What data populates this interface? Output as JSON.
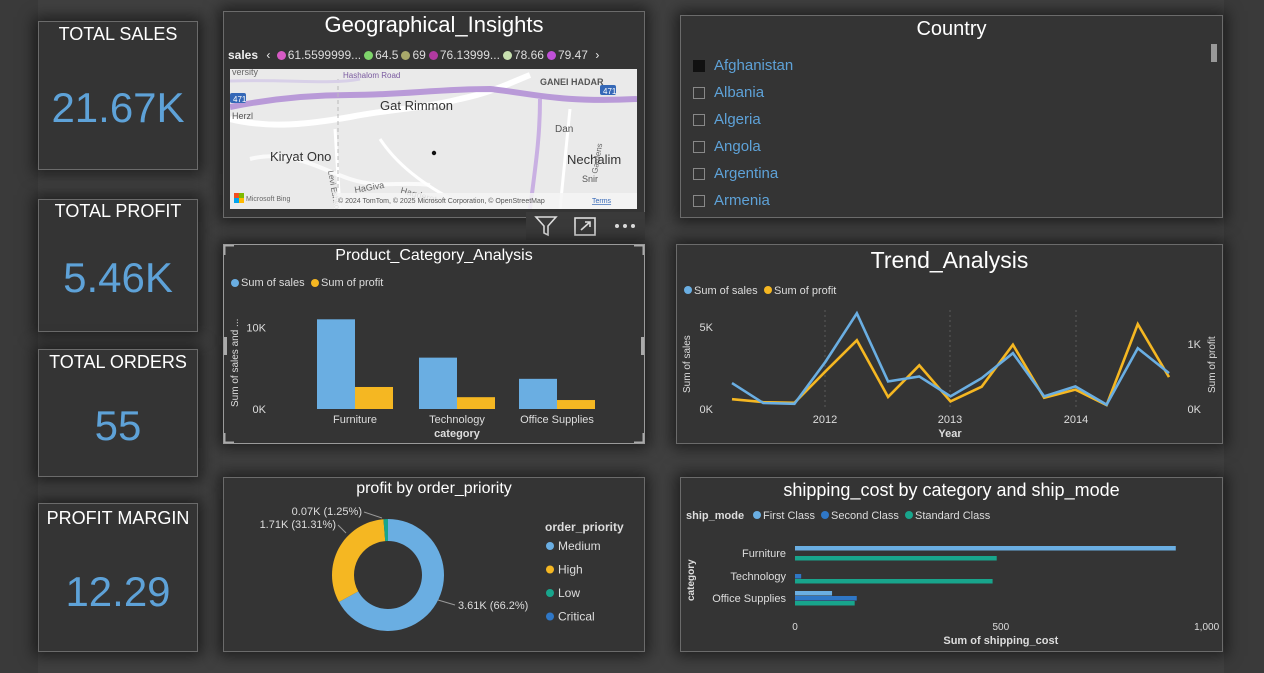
{
  "kpis": [
    {
      "label": "TOTAL SALES",
      "value": "21.67K"
    },
    {
      "label": "TOTAL PROFIT",
      "value": "5.46K"
    },
    {
      "label": "TOTAL ORDERS",
      "value": "55"
    },
    {
      "label": "PROFIT MARGIN",
      "value": "12.29"
    }
  ],
  "geo": {
    "title": "Geographical_Insights",
    "legend_title": "sales",
    "legend_items": [
      {
        "label": "61.5599999...",
        "color": "#d65ac4"
      },
      {
        "label": "64.5",
        "color": "#7ed46b"
      },
      {
        "label": "69",
        "color": "#a8a86a"
      },
      {
        "label": "76.13999...",
        "color": "#b03aa0"
      },
      {
        "label": "78.66",
        "color": "#c8e0b0"
      },
      {
        "label": "79.47",
        "color": "#c050d8"
      }
    ],
    "map_labels": {
      "top_left": "versity",
      "road": "Hashalom Road",
      "gat_rimmon": "Gat Rimmon",
      "ganei_hadar": "GANEI HADAR",
      "herzl": "Herzl",
      "kiryat_ono": "Kiryat Ono",
      "dan": "Dan",
      "nechalim": "Nechalim",
      "snir": "Snir",
      "hagiva": "HaGiva",
      "hagderot": "Hagderot",
      "levi_eshkol": "Levi Eshkol",
      "gardens": "Gardens",
      "shield_471_a": "471",
      "shield_471_b": "471",
      "attribution": "© 2024 TomTom, © 2025 Microsoft Corporation, © OpenStreetMap",
      "terms": "Terms",
      "ms_logo": "Microsoft Bing"
    }
  },
  "country": {
    "title": "Country",
    "items": [
      {
        "label": "Afghanistan",
        "checked": true
      },
      {
        "label": "Albania",
        "checked": false
      },
      {
        "label": "Algeria",
        "checked": false
      },
      {
        "label": "Angola",
        "checked": false
      },
      {
        "label": "Argentina",
        "checked": false
      },
      {
        "label": "Armenia",
        "checked": false
      }
    ]
  },
  "product": {
    "title": "Product_Category_Analysis",
    "legend": [
      "Sum of sales",
      "Sum of profit"
    ],
    "ylabel": "Sum of sales and ...",
    "xlabel": "category",
    "yticks": [
      "10K",
      "0K"
    ]
  },
  "trend": {
    "title": "Trend_Analysis",
    "legend": [
      "Sum of sales",
      "Sum of profit"
    ],
    "ylabel_left": "Sum of sales",
    "ylabel_right": "Sum of profit",
    "xlabel": "Year",
    "left_ticks": [
      "5K",
      "0K"
    ],
    "right_ticks": [
      "1K",
      "0K"
    ],
    "xticks": [
      "2012",
      "2013",
      "2014"
    ]
  },
  "donut": {
    "title": "profit by order_priority",
    "legend_title": "order_priority",
    "legend": [
      {
        "label": "Medium",
        "color": "#6aaee2"
      },
      {
        "label": "High",
        "color": "#f5b722"
      },
      {
        "label": "Low",
        "color": "#18a58c"
      },
      {
        "label": "Critical",
        "color": "#2f77c6"
      }
    ],
    "labels": [
      "0.07K (1.25%)",
      "1.71K (31.31%)",
      "3.61K (66.2%)"
    ]
  },
  "shipping": {
    "title": "shipping_cost by category and ship_mode",
    "legend_title": "ship_mode",
    "legend": [
      {
        "label": "First Class",
        "color": "#6aaee2"
      },
      {
        "label": "Second Class",
        "color": "#2f77c6"
      },
      {
        "label": "Standard Class",
        "color": "#18a58c"
      }
    ],
    "ylabel": "category",
    "xlabel": "Sum of shipping_cost",
    "xticks": [
      "0",
      "500",
      "1,000"
    ]
  },
  "chart_data": [
    {
      "type": "bar",
      "title": "Product_Category_Analysis",
      "xlabel": "category",
      "ylabel": "Sum of sales and ...",
      "categories": [
        "Furniture",
        "Technology",
        "Office Supplies"
      ],
      "series": [
        {
          "name": "Sum of sales",
          "color": "#6aaee2",
          "values": [
            11000,
            6300,
            3700
          ]
        },
        {
          "name": "Sum of profit",
          "color": "#f5b722",
          "values": [
            2700,
            1450,
            1100
          ]
        }
      ],
      "ylim": [
        0,
        13000
      ]
    },
    {
      "type": "line",
      "title": "Trend_Analysis",
      "xlabel": "Year",
      "ylabel": "Sum of sales",
      "x": [
        "2011-03",
        "2011-06",
        "2011-09",
        "2011-12",
        "2012-03",
        "2012-06",
        "2012-09",
        "2012-12",
        "2013-03",
        "2013-06",
        "2013-09",
        "2013-12",
        "2014-03",
        "2014-06",
        "2014-09",
        "2014-12"
      ],
      "series": [
        {
          "name": "Sum of sales",
          "color": "#6aaee2",
          "axis": "left",
          "values": [
            1500,
            300,
            250,
            2800,
            5700,
            1600,
            1900,
            700,
            1800,
            3300,
            700,
            1300,
            200,
            3600,
            2100
          ]
        },
        {
          "name": "Sum of profit",
          "color": "#f5b722",
          "axis": "right",
          "values": [
            120,
            80,
            70,
            500,
            920,
            150,
            580,
            90,
            290,
            860,
            140,
            250,
            40,
            1140,
            420
          ]
        }
      ],
      "ylim_left": [
        0,
        6200
      ],
      "ylim_right": [
        0,
        1400
      ]
    },
    {
      "type": "pie",
      "title": "profit by order_priority",
      "categories": [
        "Medium",
        "High",
        "Low",
        "Critical"
      ],
      "values": [
        3610,
        1710,
        70,
        0
      ],
      "percent": [
        66.2,
        31.31,
        1.25,
        0
      ]
    },
    {
      "type": "bar",
      "orientation": "horizontal",
      "title": "shipping_cost by category and ship_mode",
      "categories": [
        "Furniture",
        "Technology",
        "Office Supplies"
      ],
      "series": [
        {
          "name": "First Class",
          "color": "#6aaee2",
          "values": [
            925,
            0,
            90
          ]
        },
        {
          "name": "Second Class",
          "color": "#2f77c6",
          "values": [
            0,
            15,
            150
          ]
        },
        {
          "name": "Standard Class",
          "color": "#18a58c",
          "values": [
            490,
            480,
            145
          ]
        }
      ],
      "xlim": [
        0,
        1030
      ],
      "xlabel": "Sum of shipping_cost",
      "ylabel": "category"
    }
  ]
}
